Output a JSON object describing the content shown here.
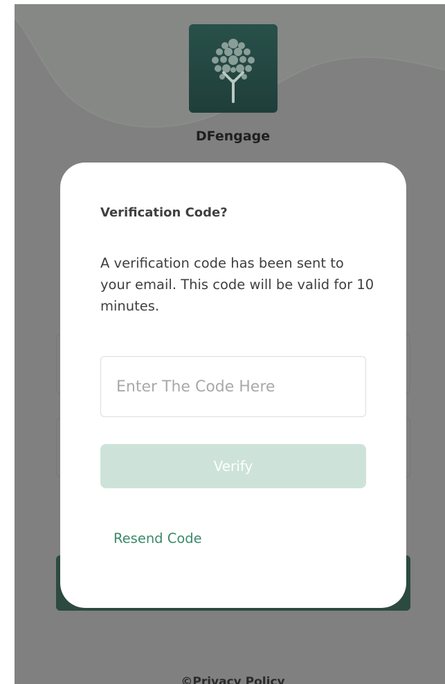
{
  "app": {
    "brand_name": "DFengage",
    "logo_icon": "tree-icon"
  },
  "background": {
    "login_button_label": "",
    "footer_link": "©Privacy Policy"
  },
  "modal": {
    "title": "Verification Code?",
    "description": "A verification code has been sent to your email. This code will be valid for 10 minutes.",
    "code_input": {
      "placeholder": "Enter The Code Here",
      "value": ""
    },
    "verify_label": "Verify",
    "resend_label": "Resend Code"
  },
  "colors": {
    "overlay": "#7f807f",
    "brand_dark_green": "#29504a",
    "button_disabled_green": "#cde3d9",
    "link_green": "#3a8a6b",
    "background_button_green": "#2c4a3f"
  }
}
